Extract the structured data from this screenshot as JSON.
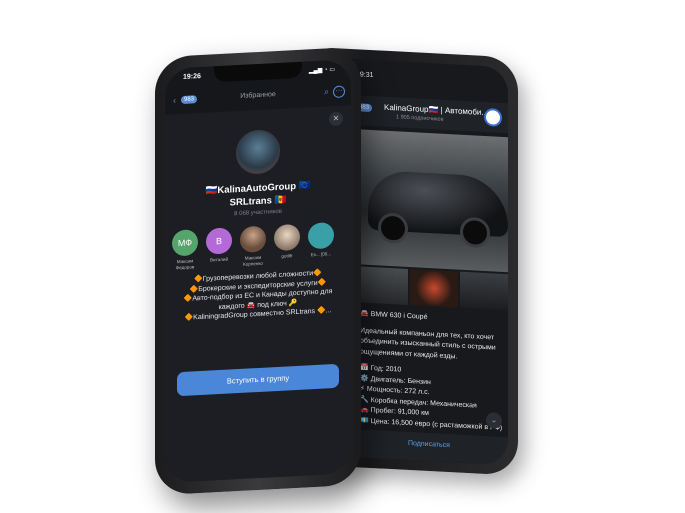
{
  "front": {
    "status_time": "19:26",
    "status_right": "▂▄▆ ◔ ▭",
    "badge": "983",
    "header_title": "Избранное",
    "group": {
      "name_line1": "🇷🇺KalinaAutoGroup 🇪🇺",
      "name_line2": "SRLtrans 🇲🇩",
      "count": "8 068 участников"
    },
    "members": [
      {
        "initials": "МФ",
        "name": "Максим Федоров",
        "color": "#54a46c"
      },
      {
        "initials": "В",
        "name": "Виталий",
        "color": "#b36ad6"
      },
      {
        "initials": "",
        "name": "Максим Корпенко",
        "color": "#6b4e3c"
      },
      {
        "initials": "",
        "name": "gotlifr",
        "color": "#c7b39a"
      },
      {
        "initials": "",
        "name": "Ev... [00...",
        "color": "#3aa0a8"
      }
    ],
    "description": [
      "🔶Грузоперевозки любой сложности🔶",
      "🔶Брокерские и экспедиторские услуги🔶",
      "🔶Авто-подбор из ЕС и Канады доступно для каждого 🚘 под ключ 🔑",
      "🔶KaliningradGroup совместно SRLtrans 🔶..."
    ],
    "join_label": "Вступить в группу"
  },
  "back": {
    "status_time": "19:31",
    "badge": "983",
    "title": "KalinaGroup🇷🇺 | Автомоби...",
    "subscribers": "1 905 подписчиков",
    "post_title": "🚘 BMW 630 i Coupé",
    "post_body": "Идеальный компаньон для тех, кто хочет объединить изысканный стиль с острыми ощущениями от каждой езды.",
    "specs": [
      "📅 Год: 2010",
      "⚙️ Двигатель: Бензин",
      "⚡ Мощность: 272 л.с.",
      "🔧 Коробка передач: Механическая",
      "🚗 Пробег: 91,000 км",
      "💶 Цена: 16,500 евро (с растаможкой в РФ)"
    ],
    "subscribe_label": "Подписаться"
  }
}
